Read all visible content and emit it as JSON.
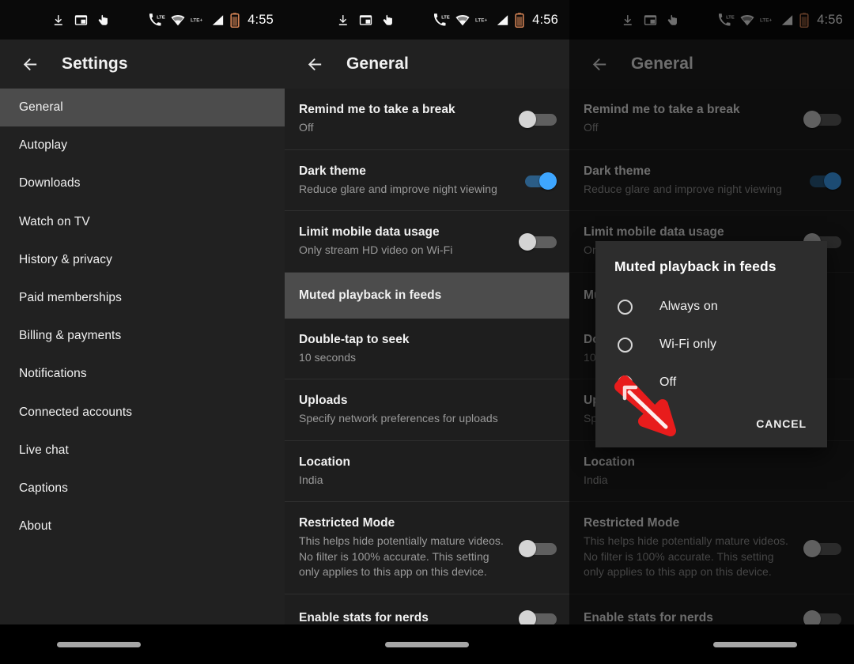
{
  "status_bar": {
    "left_icons": [
      "download-icon",
      "picture-in-picture-icon",
      "touch-hand-icon"
    ],
    "right_icons": [
      "phone-lte-icon",
      "wifi-icon",
      "lte-plus-icon",
      "signal-bars-icon",
      "battery-icon"
    ],
    "time_panel1": "4:55",
    "time_panel2": "4:56",
    "time_panel3": "4:56",
    "battery_color": "#e08a5a"
  },
  "panel1": {
    "appbar": {
      "title": "Settings",
      "back_icon": "back-arrow-icon"
    },
    "nav_items": [
      {
        "label": "General",
        "selected": true
      },
      {
        "label": "Autoplay",
        "selected": false
      },
      {
        "label": "Downloads",
        "selected": false
      },
      {
        "label": "Watch on TV",
        "selected": false
      },
      {
        "label": "History & privacy",
        "selected": false
      },
      {
        "label": "Paid memberships",
        "selected": false
      },
      {
        "label": "Billing & payments",
        "selected": false
      },
      {
        "label": "Notifications",
        "selected": false
      },
      {
        "label": "Connected accounts",
        "selected": false
      },
      {
        "label": "Live chat",
        "selected": false
      },
      {
        "label": "Captions",
        "selected": false
      },
      {
        "label": "About",
        "selected": false
      }
    ]
  },
  "panel2": {
    "appbar": {
      "title": "General",
      "back_icon": "back-arrow-icon"
    },
    "rows": [
      {
        "title": "Remind me to take a break",
        "subtitle": "Off",
        "control": "toggle",
        "toggle_on": false,
        "pressed": false
      },
      {
        "title": "Dark theme",
        "subtitle": "Reduce glare and improve night viewing",
        "control": "toggle",
        "toggle_on": true,
        "pressed": false
      },
      {
        "title": "Limit mobile data usage",
        "subtitle": "Only stream HD video on Wi-Fi",
        "control": "toggle",
        "toggle_on": false,
        "pressed": false
      },
      {
        "title": "Muted playback in feeds",
        "subtitle": "",
        "control": "none",
        "toggle_on": false,
        "pressed": true
      },
      {
        "title": "Double-tap to seek",
        "subtitle": "10 seconds",
        "control": "none",
        "toggle_on": false,
        "pressed": false
      },
      {
        "title": "Uploads",
        "subtitle": "Specify network preferences for uploads",
        "control": "none",
        "toggle_on": false,
        "pressed": false
      },
      {
        "title": "Location",
        "subtitle": "India",
        "control": "none",
        "toggle_on": false,
        "pressed": false
      },
      {
        "title": "Restricted Mode",
        "subtitle": "This helps hide potentially mature videos. No filter is 100% accurate. This setting only applies to this app on this device.",
        "control": "toggle",
        "toggle_on": false,
        "pressed": false
      },
      {
        "title": "Enable stats for nerds",
        "subtitle": "",
        "control": "toggle",
        "toggle_on": false,
        "pressed": false
      }
    ]
  },
  "panel3": {
    "appbar": {
      "title": "General",
      "back_icon": "back-arrow-icon"
    },
    "dialog": {
      "title": "Muted playback in feeds",
      "options": [
        {
          "label": "Always on",
          "selected": false
        },
        {
          "label": "Wi-Fi only",
          "selected": false
        },
        {
          "label": "Off",
          "selected": false
        }
      ],
      "cancel_label": "CANCEL"
    },
    "annotation": {
      "type": "arrow",
      "color": "#e81c1c",
      "points_at": "Off"
    }
  },
  "nav_bar": {
    "pill": "home-gesture-pill"
  },
  "theme": {
    "background": "#1e1e1e",
    "appbar_bg": "#212121",
    "selected_bg": "#4c4c4c",
    "accent_blue": "#3ea6ff",
    "title_text": "#f1f1f1",
    "subtitle_text": "#9a9a9a"
  }
}
